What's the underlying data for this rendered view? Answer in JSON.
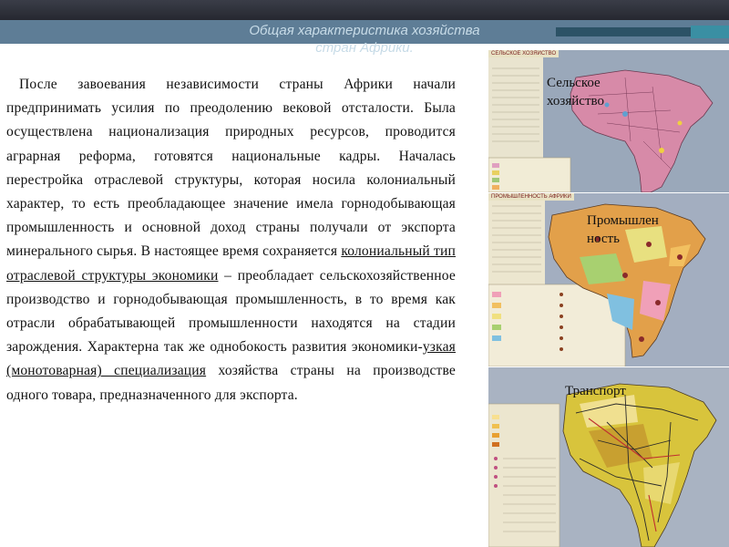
{
  "header": {
    "title_line1": "Общая характеристика хозяйства",
    "title_line2": "стран Африки."
  },
  "body": {
    "segments": [
      "После завоевания независимости страны Африки начали предпринимать усилия по преодолению вековой отсталости. Была осуществлена национализация природных ресурсов, проводится аграрная реформа, готовятся национальные кадры. Началась перестройка отраслевой структуры, которая носила колониальный характер, то есть преобладающее значение имела горнодобывающая промышленность и основной доход страны получали от экспорта минерального сырья.  В настоящее время сохраняется ",
      "колониальный тип отраслевой структуры экономики",
      " – преобладает сельскохозяйственное производство и горнодобывающая промышленность, в то время как отрасли обрабатывающей промышленности находятся на стадии зарождения. Характерна так же однобокость развития экономики-",
      "узкая (монотоварная) специализация",
      " хозяйства страны на производстве одного товара, предназначенного для экспорта."
    ]
  },
  "maps": [
    {
      "label": "Сельское хозяйство",
      "header": "СЕЛЬСКОЕ ХОЗЯЙСТВО"
    },
    {
      "label": "Промышленность",
      "header": "ПРОМЫШЛЕННОСТЬ АФРИКИ"
    },
    {
      "label": "Транспорт",
      "header": ""
    }
  ],
  "colors": {
    "title": "#c7dbe7",
    "topbar": "#2d3039",
    "accent": "#5e7d96",
    "map1_land": "#d78aa8",
    "map2_land": "#e2a04a",
    "map3_land": "#d8c43c"
  }
}
